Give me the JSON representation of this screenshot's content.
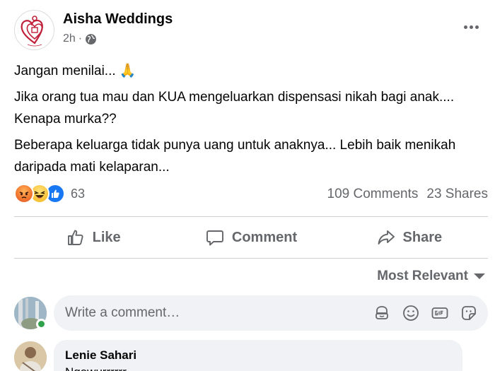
{
  "post": {
    "page_name": "Aisha Weddings",
    "time": "2h",
    "separator": "·",
    "audience_icon": "globe-icon",
    "paragraphs": [
      "Jangan menilai... 🙏",
      "Jika orang tua mau dan KUA mengeluarkan dispensasi nikah bagi anak.... Kenapa murka??",
      "Beberapa keluarga tidak punya uang untuk anaknya... Lebih baik menikah daripada mati kelaparan..."
    ]
  },
  "stats": {
    "reaction_icons": [
      "angry-reaction-icon",
      "haha-reaction-icon",
      "like-reaction-icon"
    ],
    "reaction_count": "63",
    "comments": "109 Comments",
    "shares": "23 Shares"
  },
  "actions": {
    "like": "Like",
    "comment": "Comment",
    "share": "Share"
  },
  "sort": {
    "label": "Most Relevant"
  },
  "composer": {
    "placeholder": "Write a comment…"
  },
  "first_comment": {
    "author": "Lenie Sahari",
    "text": "Ngawurrrrrr"
  },
  "colors": {
    "secondary_text": "#65676b",
    "online": "#31a24c",
    "like_blue": "#1877f2",
    "brand_red": "#c0203a"
  }
}
